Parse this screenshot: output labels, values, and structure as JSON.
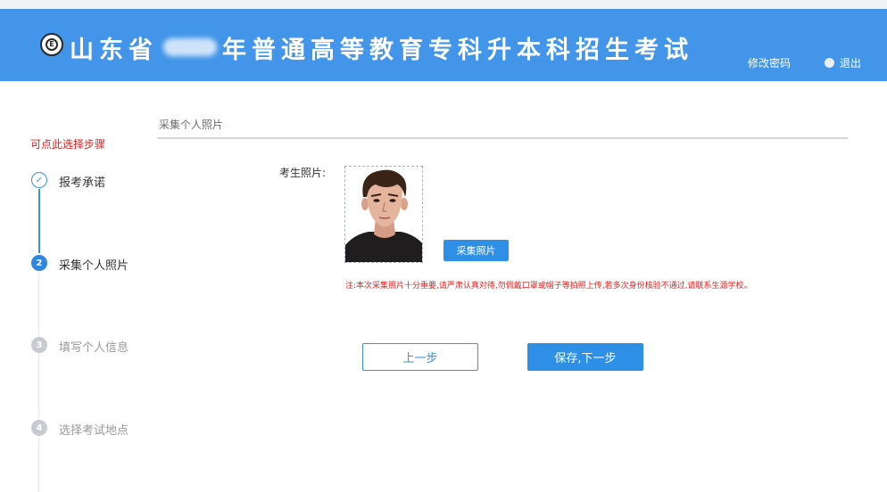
{
  "header": {
    "title_part1": "山东省",
    "title_part2": "年普通高等教育专科升本科招生考试",
    "logo_letter": "E",
    "change_password": "修改密码",
    "logout": "退出",
    "bg_color": "#4295e8"
  },
  "sidebar": {
    "hint": "可点此选择步骤",
    "steps": [
      {
        "number": "✓",
        "label": "报考承诺",
        "state": "done"
      },
      {
        "number": "2",
        "label": "采集个人照片",
        "state": "active"
      },
      {
        "number": "3",
        "label": "填写个人信息",
        "state": "todo"
      },
      {
        "number": "4",
        "label": "选择考试地点",
        "state": "todo"
      }
    ]
  },
  "main": {
    "section_title": "采集个人照片",
    "photo_label": "考生照片:",
    "capture_button": "采集照片",
    "notice": "注:本次采集照片十分重要,请严肃认真对待,勿佩戴口罩或帽子等拍照上传,若多次身份核验不通过,请联系生源学校。"
  },
  "actions": {
    "prev": "上一步",
    "next": "保存,下一步"
  },
  "colors": {
    "accent": "#2e8fe6",
    "warning": "#e02020"
  }
}
